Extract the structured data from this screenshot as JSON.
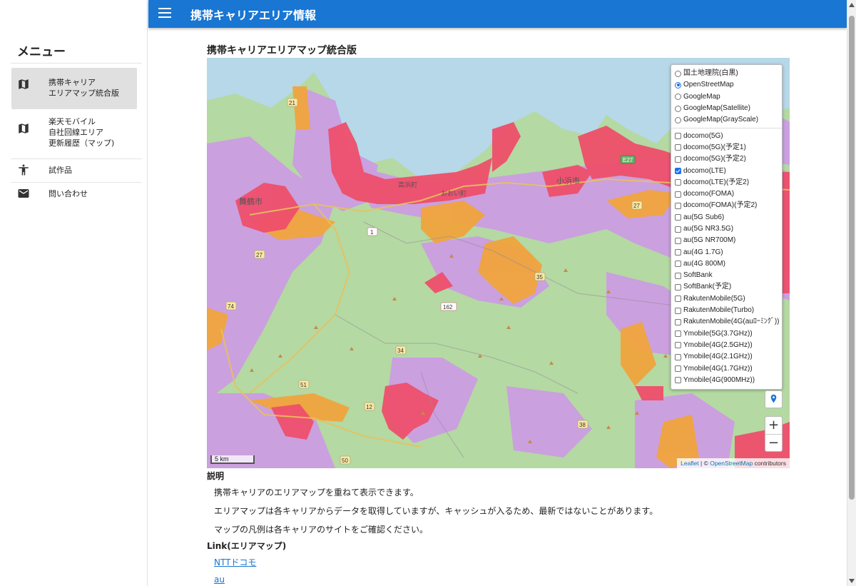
{
  "app": {
    "title": "携帯キャリアエリア情報"
  },
  "sidebar": {
    "title": "メニュー",
    "items": [
      {
        "label_lines": [
          "携帯キャリア",
          "エリアマップ統合版"
        ],
        "icon": "map-icon",
        "active": true
      },
      {
        "label_lines": [
          "楽天モバイル",
          "自社回線エリア",
          "更新履歴（マップ)"
        ],
        "icon": "map-icon",
        "active": false
      },
      {
        "label_lines": [
          "試作品"
        ],
        "icon": "accessibility-icon",
        "active": false
      },
      {
        "label_lines": [
          "問い合わせ"
        ],
        "icon": "mail-icon",
        "active": false
      }
    ]
  },
  "main": {
    "page_title": "携帯キャリアエリアマップ統合版"
  },
  "map": {
    "base_layers": [
      {
        "label": "国土地理院(白黒)",
        "selected": false
      },
      {
        "label": "OpenStreetMap",
        "selected": true
      },
      {
        "label": "GoogleMap",
        "selected": false
      },
      {
        "label": "GoogleMap(Satellite)",
        "selected": false
      },
      {
        "label": "GoogleMap(GrayScale)",
        "selected": false
      }
    ],
    "overlays": [
      {
        "label": "docomo(5G)",
        "checked": false
      },
      {
        "label": "docomo(5G)(予定1)",
        "checked": false
      },
      {
        "label": "docomo(5G)(予定2)",
        "checked": false
      },
      {
        "label": "docomo(LTE)",
        "checked": true
      },
      {
        "label": "docomo(LTE)(予定2)",
        "checked": false
      },
      {
        "label": "docomo(FOMA)",
        "checked": false
      },
      {
        "label": "docomo(FOMA)(予定2)",
        "checked": false
      },
      {
        "label": "au(5G Sub6)",
        "checked": false
      },
      {
        "label": "au(5G NR3.5G)",
        "checked": false
      },
      {
        "label": "au(5G NR700M)",
        "checked": false
      },
      {
        "label": "au(4G 1.7G)",
        "checked": false
      },
      {
        "label": "au(4G 800M)",
        "checked": false
      },
      {
        "label": "SoftBank",
        "checked": false
      },
      {
        "label": "SoftBank(予定)",
        "checked": false
      },
      {
        "label": "RakutenMobile(5G)",
        "checked": false
      },
      {
        "label": "RakutenMobile(Turbo)",
        "checked": false
      },
      {
        "label": "RakutenMobile(4G(auﾛｰﾐﾝｸﾞ))",
        "checked": false
      },
      {
        "label": "Ymobile(5G(3.7GHz))",
        "checked": false
      },
      {
        "label": "Ymobile(4G(2.5GHz))",
        "checked": false
      },
      {
        "label": "Ymobile(4G(2.1GHz))",
        "checked": false
      },
      {
        "label": "Ymobile(4G(1.7GHz))",
        "checked": false
      },
      {
        "label": "Ymobile(4G(900MHz))",
        "checked": false
      }
    ],
    "zoom_in": "+",
    "zoom_out": "−",
    "scale_label": "5 km",
    "attribution": {
      "leaflet": "Leaflet",
      "sep": " | © ",
      "osm": "OpenStreetMap",
      "suffix": " contributors"
    },
    "place_labels": {
      "maizuru": "舞鶴市",
      "obama": "小浜市",
      "ooi": "おおい町",
      "takahama": "高浜町",
      "route_27a": "27",
      "route_27b": "27",
      "route_1": "1",
      "route_162": "162",
      "route_35": "35",
      "route_74": "74",
      "route_34": "34",
      "route_51": "51",
      "route_12": "12",
      "route_38": "38",
      "route_50": "50",
      "route_21": "21",
      "route_e27": "E27"
    },
    "colors": {
      "water": "#b6d8e8",
      "land": "#b4d9a3",
      "purple": "#cc9de3",
      "red": "#ee4f6b",
      "orange": "#f0a43d"
    }
  },
  "description": {
    "heading": "説明",
    "lines": [
      "携帯キャリアのエリアマップを重ねて表示できます。",
      "エリアマップは各キャリアからデータを取得していますが、キャッシュが入るため、最新ではないことがあります。",
      "マップの凡例は各キャリアのサイトをご確認ください。"
    ]
  },
  "links": {
    "heading": "Link(エリアマップ)",
    "items": [
      "NTTドコモ",
      "au"
    ]
  }
}
